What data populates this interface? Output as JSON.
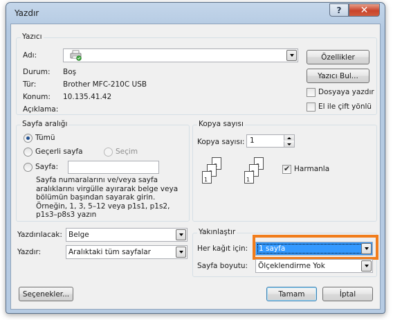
{
  "window": {
    "title": "Yazdır",
    "help_label": "?",
    "close_label": "✕"
  },
  "printer": {
    "group_label": "Yazıcı",
    "name_label": "Adı:",
    "status_label": "Durum:",
    "status_value": "Boş",
    "type_label": "Tür:",
    "type_value": "Brother MFC-210C USB",
    "location_label": "Konum:",
    "location_value": "10.135.41.42",
    "comment_label": "Açıklama:",
    "comment_value": "",
    "properties_button": "Özellikler",
    "find_printer_button": "Yazıcı Bul...",
    "print_to_file_label": "Dosyaya yazdır",
    "print_to_file_checked": false,
    "manual_duplex_label": "El ile çift yönlü",
    "manual_duplex_checked": false
  },
  "page_range": {
    "group_label": "Sayfa aralığı",
    "all_label": "Tümü",
    "current_page_label": "Geçerli sayfa",
    "selection_label": "Seçim",
    "pages_label": "Sayfa:",
    "pages_value": "",
    "selected": "all",
    "help_text": "Sayfa numaralarını ve/veya sayfa aralıklarını virgülle ayırarak belge veya bölümün başından sayarak girin. Örneğin, 1, 3, 5–12 veya p1s1, p1s2, p1s3–p8s3 yazın"
  },
  "copies": {
    "group_label": "Kopya sayısı",
    "count_label": "Kopya sayısı:",
    "count_value": "1",
    "collate_label": "Harmanla",
    "collate_checked": true,
    "page_numbers": [
      "1",
      "2",
      "3"
    ]
  },
  "print_what": {
    "label": "Yazdırılacak:",
    "value": "Belge"
  },
  "print": {
    "label": "Yazdır:",
    "value": "Aralıktaki tüm sayfalar"
  },
  "zoom": {
    "group_label": "Yakınlaştır",
    "pages_per_sheet_label": "Her kağıt için:",
    "pages_per_sheet_value": "1 sayfa",
    "scale_label": "Sayfa boyutu:",
    "scale_value": "Ölçeklendirme Yok"
  },
  "footer": {
    "options_button": "Seçenekler...",
    "ok_button": "Tamam",
    "cancel_button": "İptal"
  },
  "colors": {
    "highlight": "#f17d1c",
    "selection": "#3399ff"
  }
}
